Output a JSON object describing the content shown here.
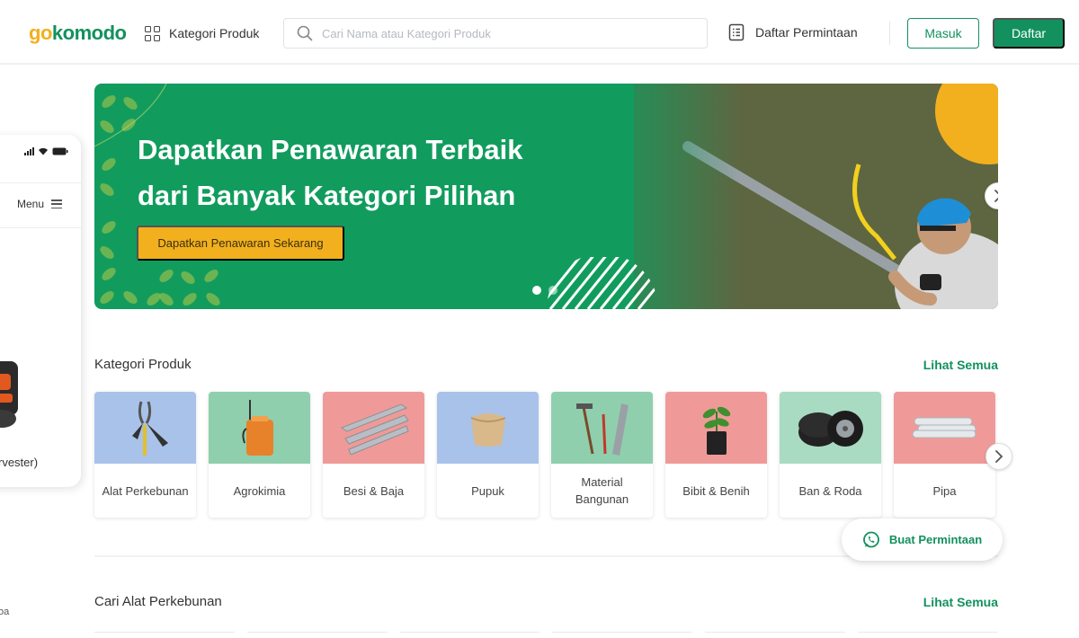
{
  "header": {
    "logo_go": "go",
    "logo_komodo": "komodo",
    "category_label": "Kategori Produk",
    "search_placeholder": "Cari Nama atau Kategori Produk",
    "request_list_label": "Daftar Permintaan",
    "login_label": "Masuk",
    "register_label": "Daftar"
  },
  "phone": {
    "menu_label": "Menu",
    "product_label": "rvester)",
    "caption": "oa"
  },
  "hero": {
    "title_line1": "Dapatkan Penawaran Terbaik",
    "title_line2": "dari Banyak Kategori Pilihan",
    "cta_label": "Dapatkan Penawaran Sekarang",
    "slide_count": 2,
    "active_slide": 1
  },
  "categories_section": {
    "title": "Kategori Produk",
    "see_all": "Lihat Semua",
    "items": [
      {
        "label": "Alat Perkebunan",
        "bg": "#a9c2ea",
        "icon": "pruner-icon"
      },
      {
        "label": "Agrokimia",
        "bg": "#8fcfae",
        "icon": "sprayer-icon"
      },
      {
        "label": "Besi & Baja",
        "bg": "#ef9a98",
        "icon": "steel-beams-icon"
      },
      {
        "label": "Pupuk",
        "bg": "#a9c2ea",
        "icon": "fertilizer-sack-icon"
      },
      {
        "label": "Material Bangunan",
        "bg": "#8fcfae",
        "icon": "building-tools-icon"
      },
      {
        "label": "Bibit & Benih",
        "bg": "#ef9a98",
        "icon": "seedling-pot-icon"
      },
      {
        "label": "Ban & Roda",
        "bg": "#a8dbc2",
        "icon": "tires-icon"
      },
      {
        "label": "Pipa",
        "bg": "#ef9a98",
        "icon": "pipes-icon"
      }
    ]
  },
  "tools_section": {
    "title": "Cari Alat Perkebunan",
    "see_all": "Lihat Semua"
  },
  "whatsapp": {
    "label": "Buat Permintaan",
    "icon": "whatsapp-icon"
  },
  "colors": {
    "brand_green": "#12915e",
    "brand_yellow": "#f2b01e",
    "hero_green": "#119c5e"
  }
}
